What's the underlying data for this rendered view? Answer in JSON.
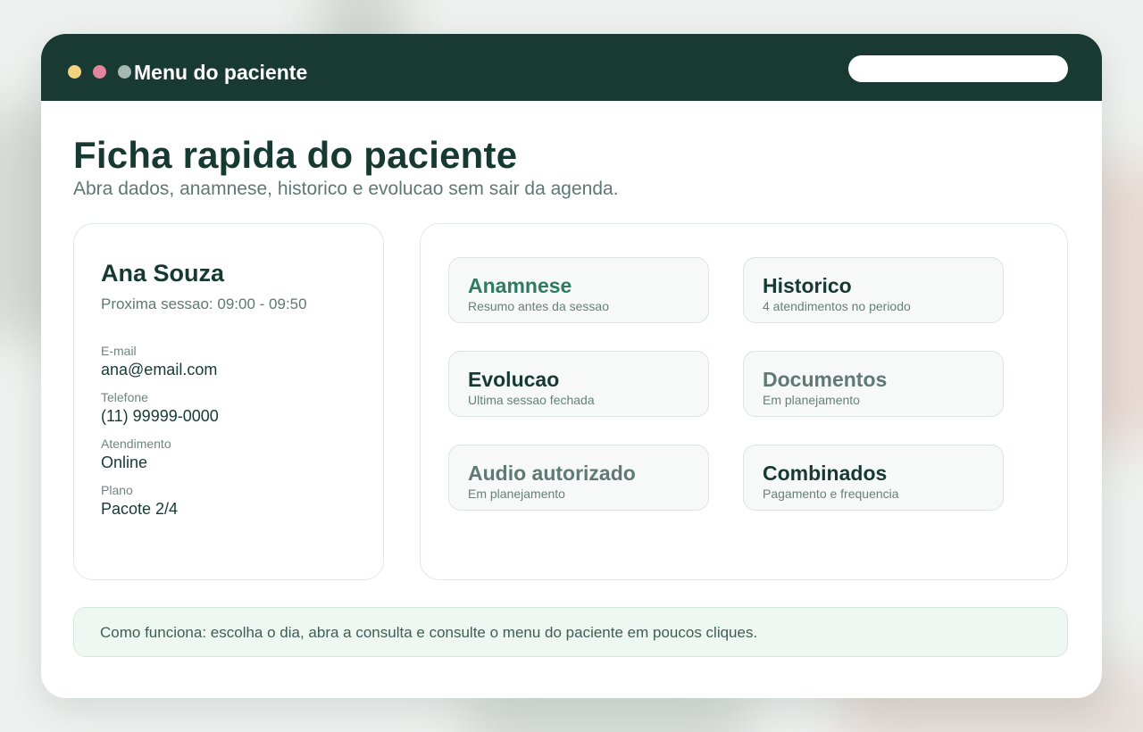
{
  "window": {
    "title": "Menu do paciente",
    "search": {
      "value": "",
      "placeholder": ""
    }
  },
  "page": {
    "title": "Ficha rapida do paciente",
    "subtitle": "Abra dados, anamnese, historico e evolucao sem sair da agenda."
  },
  "patient": {
    "name": "Ana Souza",
    "next_session": "Proxima sessao: 09:00 - 09:50",
    "fields": [
      {
        "label": "E-mail",
        "value": "ana@email.com"
      },
      {
        "label": "Telefone",
        "value": "(11) 99999-0000"
      },
      {
        "label": "Atendimento",
        "value": "Online"
      },
      {
        "label": "Plano",
        "value": "Pacote 2/4"
      }
    ]
  },
  "menu": {
    "items": [
      {
        "title": "Anamnese",
        "subtitle": "Resumo antes da sessao"
      },
      {
        "title": "Historico",
        "subtitle": "4 atendimentos no periodo"
      },
      {
        "title": "Evolucao",
        "subtitle": "Ultima sessao fechada"
      },
      {
        "title": "Documentos",
        "subtitle": "Em planejamento"
      },
      {
        "title": "Audio autorizado",
        "subtitle": "Em planejamento"
      },
      {
        "title": "Combinados",
        "subtitle": "Pagamento e frequencia"
      }
    ]
  },
  "info": {
    "text": "Como funciona: escolha o dia, abra a consulta e consulte o menu do paciente em poucos cliques."
  },
  "colors": {
    "titlebar": "#193a33",
    "primary_text": "#163a32",
    "accent": "#2f7a63",
    "muted": "#5f7a73",
    "dot_yellow": "#f3d27e",
    "dot_pink": "#e384a1",
    "dot_gray": "#a4b9b1"
  }
}
